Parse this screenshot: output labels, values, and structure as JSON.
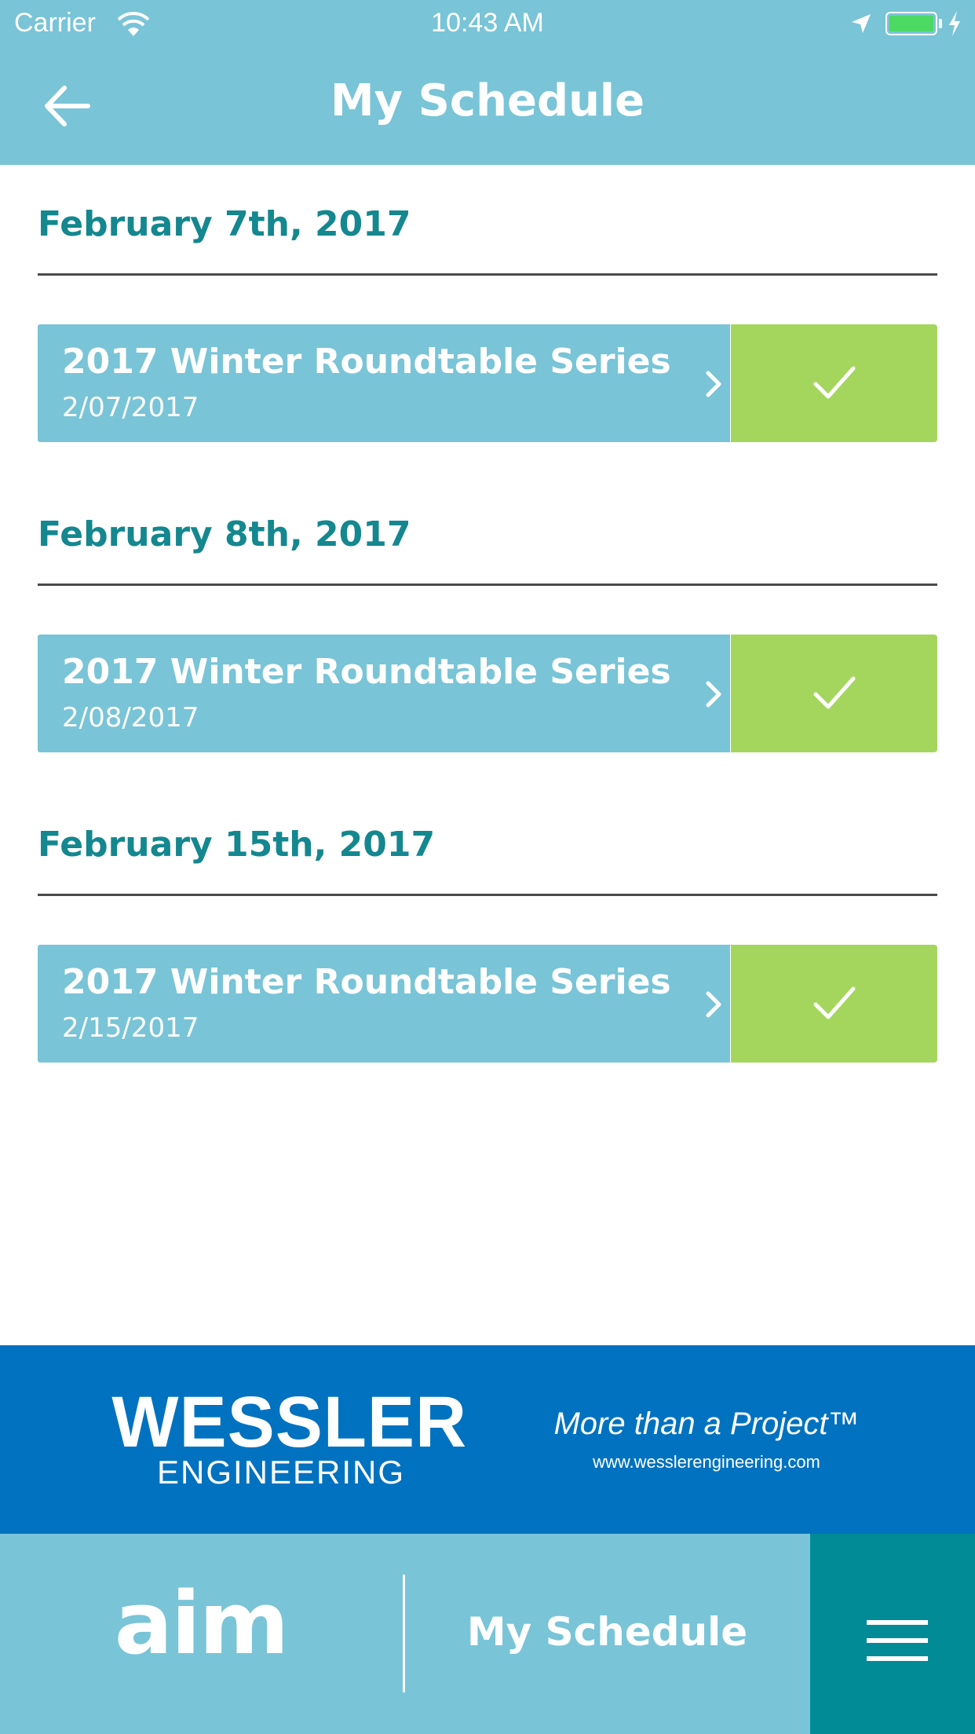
{
  "status_bar": {
    "carrier": "Carrier",
    "time": "10:43 AM",
    "battery_color": "#4cd964"
  },
  "header": {
    "title": "My Schedule",
    "back_icon": "arrow-left-icon",
    "background": "#79c4d7"
  },
  "schedule": [
    {
      "date_heading": "February 7th, 2017",
      "event_title": "2017 Winter Roundtable Series",
      "event_date": "2/07/2017"
    },
    {
      "date_heading": "February 8th, 2017",
      "event_title": "2017 Winter Roundtable Series",
      "event_date": "2/08/2017"
    },
    {
      "date_heading": "February 15th, 2017",
      "event_title": "2017 Winter Roundtable Series",
      "event_date": "2/15/2017"
    }
  ],
  "colors": {
    "heading": "#14878f",
    "card": "#79c4d7",
    "check": "#a4d65e",
    "banner": "#0072bf",
    "menu": "#008b96"
  },
  "banner": {
    "brand_name": "WESSLER",
    "brand_sub": "ENGINEERING",
    "tagline": "More than a Project™",
    "website": "www.wesslerengineering.com"
  },
  "bottom_bar": {
    "logo": "aim",
    "current_section": "My Schedule",
    "menu_icon": "hamburger-menu-icon"
  }
}
